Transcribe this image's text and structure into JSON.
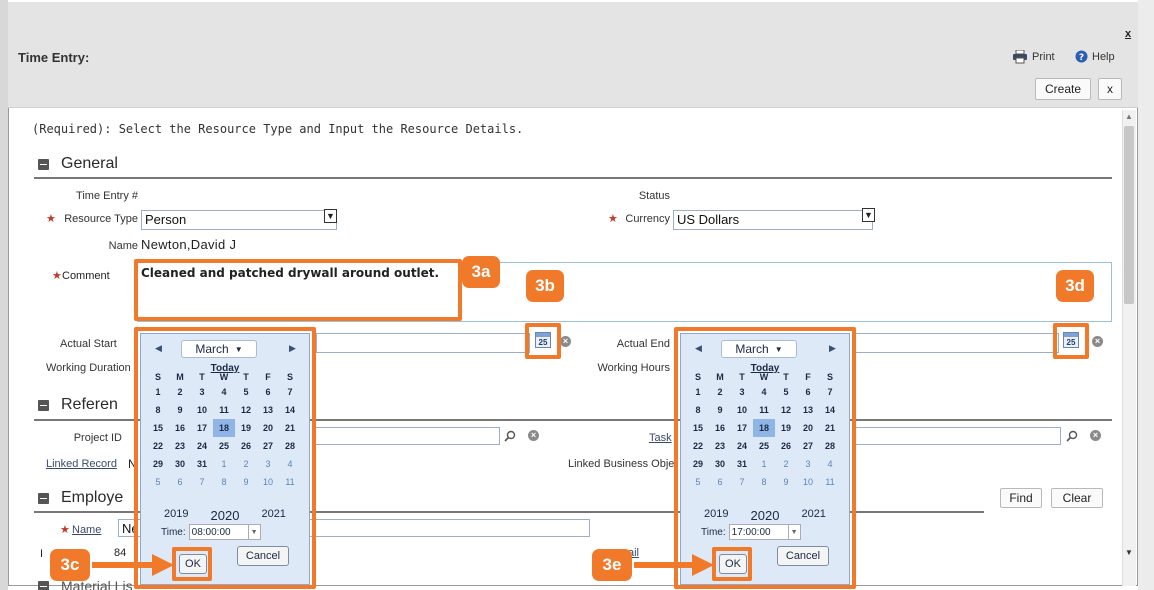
{
  "window": {
    "title": "Time Entry:",
    "close_label": "x",
    "print_label": "Print",
    "help_label": "Help"
  },
  "toolbar": {
    "create_label": "Create",
    "cancel_label": "x"
  },
  "instruction": "(Required): Select the Resource Type and Input the Resource Details.",
  "sections": {
    "general": "General",
    "reference": "Referen",
    "employee": "Employe",
    "material": "Material Lis"
  },
  "general": {
    "time_entry_label": "Time Entry #",
    "status_label": "Status",
    "resource_type_label": "Resource Type",
    "resource_type_value": "Person",
    "currency_label": "Currency",
    "currency_value": "US Dollars",
    "name_label": "Name",
    "name_value": "Newton,David J",
    "comments_label": "Comment",
    "comments_value": "Cleaned and patched drywall around outlet.",
    "actual_start_label": "Actual Start",
    "actual_end_label": "Actual End",
    "working_duration_label": "Working Duration",
    "working_hours_label": "Working Hours"
  },
  "reference": {
    "project_id_label": "Project ID",
    "task_label": "Task",
    "linked_record_label": "Linked Record",
    "linked_record_value": "N",
    "linked_business_label": "Linked Business Obje"
  },
  "employee": {
    "name_label": "Name",
    "name_value": "Ne",
    "next_label": "I",
    "next_value": "84",
    "find_label": "Find",
    "clear_label": "Clear",
    "email_label": "ail"
  },
  "calendar_start": {
    "month": "March",
    "today_label": "Today",
    "weekdays": [
      "S",
      "M",
      "T",
      "W",
      "T",
      "F",
      "S"
    ],
    "weeks": [
      [
        "1",
        "2",
        "3",
        "4",
        "5",
        "6",
        "7"
      ],
      [
        "8",
        "9",
        "10",
        "11",
        "12",
        "13",
        "14"
      ],
      [
        "15",
        "16",
        "17",
        "18",
        "19",
        "20",
        "21"
      ],
      [
        "22",
        "23",
        "24",
        "25",
        "26",
        "27",
        "28"
      ],
      [
        "29",
        "30",
        "31",
        "1",
        "2",
        "3",
        "4"
      ],
      [
        "5",
        "6",
        "7",
        "8",
        "9",
        "10",
        "11"
      ]
    ],
    "selected_day": "18",
    "prev_year": "2019",
    "current_year": "2020",
    "next_year": "2021",
    "time_label": "Time:",
    "time_value": "08:00:00",
    "ok_label": "OK",
    "cancel_label": "Cancel"
  },
  "calendar_end": {
    "month": "March",
    "today_label": "Today",
    "weekdays": [
      "S",
      "M",
      "T",
      "W",
      "T",
      "F",
      "S"
    ],
    "weeks": [
      [
        "1",
        "2",
        "3",
        "4",
        "5",
        "6",
        "7"
      ],
      [
        "8",
        "9",
        "10",
        "11",
        "12",
        "13",
        "14"
      ],
      [
        "15",
        "16",
        "17",
        "18",
        "19",
        "20",
        "21"
      ],
      [
        "22",
        "23",
        "24",
        "25",
        "26",
        "27",
        "28"
      ],
      [
        "29",
        "30",
        "31",
        "1",
        "2",
        "3",
        "4"
      ],
      [
        "5",
        "6",
        "7",
        "8",
        "9",
        "10",
        "11"
      ]
    ],
    "selected_day": "18",
    "prev_year": "2019",
    "current_year": "2020",
    "next_year": "2021",
    "time_label": "Time:",
    "time_value": "17:00:00",
    "ok_label": "OK",
    "cancel_label": "Cancel"
  },
  "calendar_icon_text": "25",
  "callouts": {
    "a": "3a",
    "b": "3b",
    "c": "3c",
    "d": "3d",
    "e": "3e"
  },
  "colors": {
    "accent": "#f07a2a",
    "selected_day": "#8fb5e6",
    "calendar_bg": "#dde9f7"
  }
}
